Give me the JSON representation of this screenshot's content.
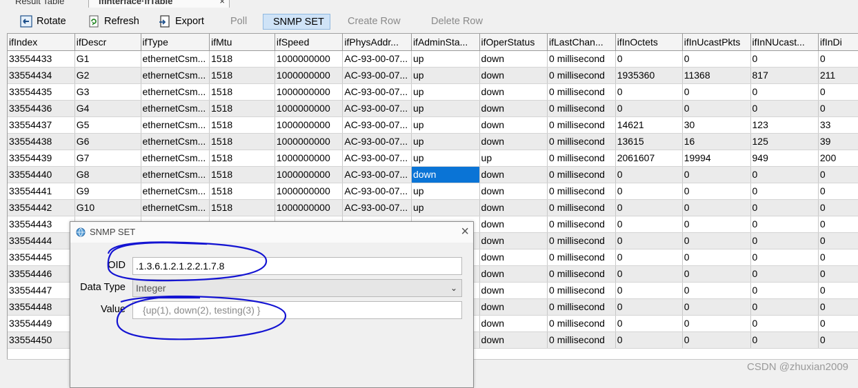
{
  "tabs": [
    {
      "label": "Result Table"
    },
    {
      "label": "ifInterface·ifTable",
      "close": "×"
    }
  ],
  "toolbar": {
    "rotate": "Rotate",
    "refresh": "Refresh",
    "export": "Export",
    "poll": "Poll",
    "snmp_set": "SNMP SET",
    "create_row": "Create Row",
    "delete_row": "Delete Row"
  },
  "columns": [
    "ifIndex",
    "ifDescr",
    "ifType",
    "ifMtu",
    "ifSpeed",
    "ifPhysAddr...",
    "ifAdminSta...",
    "ifOperStatus",
    "ifLastChan...",
    "ifInOctets",
    "ifInUcastPkts",
    "ifInNUcast...",
    "ifInDi"
  ],
  "rows": [
    [
      "33554433",
      "G1",
      "ethernetCsm...",
      "1518",
      "1000000000",
      "AC-93-00-07...",
      "up",
      "down",
      "0 millisecond",
      "0",
      "0",
      "0",
      "0"
    ],
    [
      "33554434",
      "G2",
      "ethernetCsm...",
      "1518",
      "1000000000",
      "AC-93-00-07...",
      "up",
      "down",
      "0 millisecond",
      "1935360",
      "11368",
      "817",
      "211"
    ],
    [
      "33554435",
      "G3",
      "ethernetCsm...",
      "1518",
      "1000000000",
      "AC-93-00-07...",
      "up",
      "down",
      "0 millisecond",
      "0",
      "0",
      "0",
      "0"
    ],
    [
      "33554436",
      "G4",
      "ethernetCsm...",
      "1518",
      "1000000000",
      "AC-93-00-07...",
      "up",
      "down",
      "0 millisecond",
      "0",
      "0",
      "0",
      "0"
    ],
    [
      "33554437",
      "G5",
      "ethernetCsm...",
      "1518",
      "1000000000",
      "AC-93-00-07...",
      "up",
      "down",
      "0 millisecond",
      "14621",
      "30",
      "123",
      "33"
    ],
    [
      "33554438",
      "G6",
      "ethernetCsm...",
      "1518",
      "1000000000",
      "AC-93-00-07...",
      "up",
      "down",
      "0 millisecond",
      "13615",
      "16",
      "125",
      "39"
    ],
    [
      "33554439",
      "G7",
      "ethernetCsm...",
      "1518",
      "1000000000",
      "AC-93-00-07...",
      "up",
      "up",
      "0 millisecond",
      "2061607",
      "19994",
      "949",
      "200"
    ],
    [
      "33554440",
      "G8",
      "ethernetCsm...",
      "1518",
      "1000000000",
      "AC-93-00-07...",
      "down",
      "down",
      "0 millisecond",
      "0",
      "0",
      "0",
      "0"
    ],
    [
      "33554441",
      "G9",
      "ethernetCsm...",
      "1518",
      "1000000000",
      "AC-93-00-07...",
      "up",
      "down",
      "0 millisecond",
      "0",
      "0",
      "0",
      "0"
    ],
    [
      "33554442",
      "G10",
      "ethernetCsm...",
      "1518",
      "1000000000",
      "AC-93-00-07...",
      "up",
      "down",
      "0 millisecond",
      "0",
      "0",
      "0",
      "0"
    ],
    [
      "33554443",
      "",
      "",
      "",
      "",
      "",
      "",
      "down",
      "0 millisecond",
      "0",
      "0",
      "0",
      "0"
    ],
    [
      "33554444",
      "",
      "",
      "",
      "",
      "",
      "",
      "down",
      "0 millisecond",
      "0",
      "0",
      "0",
      "0"
    ],
    [
      "33554445",
      "",
      "",
      "",
      "",
      "",
      "",
      "down",
      "0 millisecond",
      "0",
      "0",
      "0",
      "0"
    ],
    [
      "33554446",
      "",
      "",
      "",
      "",
      "",
      "",
      "down",
      "0 millisecond",
      "0",
      "0",
      "0",
      "0"
    ],
    [
      "33554447",
      "",
      "",
      "",
      "",
      "",
      "",
      "down",
      "0 millisecond",
      "0",
      "0",
      "0",
      "0"
    ],
    [
      "33554448",
      "",
      "",
      "",
      "",
      "",
      "",
      "down",
      "0 millisecond",
      "0",
      "0",
      "0",
      "0"
    ],
    [
      "33554449",
      "",
      "",
      "",
      "",
      "",
      "",
      "down",
      "0 millisecond",
      "0",
      "0",
      "0",
      "0"
    ],
    [
      "33554450",
      "",
      "",
      "",
      "",
      "",
      "",
      "down",
      "0 millisecond",
      "0",
      "0",
      "0",
      "0"
    ]
  ],
  "selected_cell": {
    "row": 7,
    "col": 6
  },
  "dialog": {
    "title": "SNMP SET",
    "close": "×",
    "oid_label": "OID",
    "oid_value": ".1.3.6.1.2.1.2.2.1.7.8",
    "datatype_label": "Data Type",
    "datatype_value": "Integer",
    "value_label": "Value",
    "value_placeholder": "{up(1), down(2), testing(3) }"
  },
  "watermark": "CSDN @zhuxian2009",
  "colors": {
    "selection": "#0a74d6",
    "annotation": "#1414d2",
    "active_button": "#cfe3f7"
  }
}
